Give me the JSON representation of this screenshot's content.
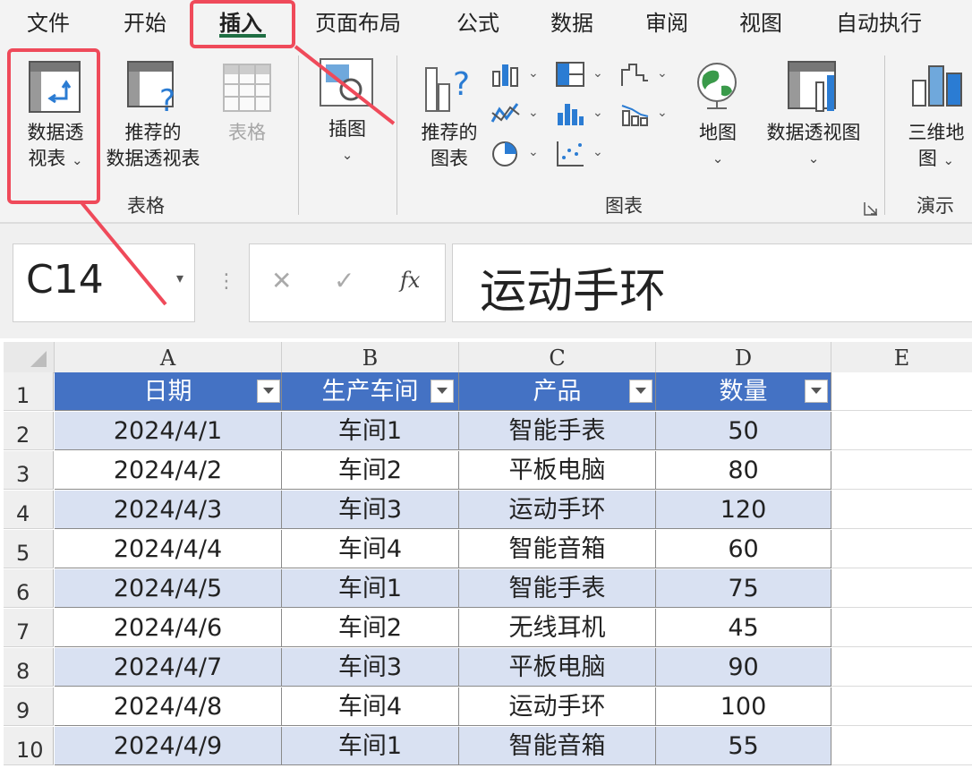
{
  "ribbon_tabs": [
    "文件",
    "开始",
    "插入",
    "页面布局",
    "公式",
    "数据",
    "审阅",
    "视图",
    "自动执行"
  ],
  "ribbon": {
    "pivot_table": {
      "line1": "数据透",
      "line2": "视表"
    },
    "recommended_pivot": {
      "line1": "推荐的",
      "line2": "数据透视表"
    },
    "table": "表格",
    "group_tables": "表格",
    "illustrations": "插图",
    "recommended_charts": {
      "line1": "推荐的",
      "line2": "图表"
    },
    "map": "地图",
    "pivot_chart": "数据透视图",
    "group_charts": "图表",
    "map_3d": {
      "line1": "三维地",
      "line2": "图"
    },
    "group_tours": "演示"
  },
  "formula_bar": {
    "name_box": "C14",
    "cancel_glyph": "✕",
    "enter_glyph": "✓",
    "fx_glyph": "fx",
    "content": "运动手环"
  },
  "sheet": {
    "column_letters": [
      "A",
      "B",
      "C",
      "D",
      "E"
    ],
    "headers": [
      "日期",
      "生产车间",
      "产品",
      "数量"
    ],
    "row_numbers": [
      "1",
      "2",
      "3",
      "4",
      "5",
      "6",
      "7",
      "8",
      "9",
      "10"
    ],
    "rows": [
      [
        "2024/4/1",
        "车间1",
        "智能手表",
        "50"
      ],
      [
        "2024/4/2",
        "车间2",
        "平板电脑",
        "80"
      ],
      [
        "2024/4/3",
        "车间3",
        "运动手环",
        "120"
      ],
      [
        "2024/4/4",
        "车间4",
        "智能音箱",
        "60"
      ],
      [
        "2024/4/5",
        "车间1",
        "智能手表",
        "75"
      ],
      [
        "2024/4/6",
        "车间2",
        "无线耳机",
        "45"
      ],
      [
        "2024/4/7",
        "车间3",
        "平板电脑",
        "90"
      ],
      [
        "2024/4/8",
        "车间4",
        "运动手环",
        "100"
      ],
      [
        "2024/4/9",
        "车间1",
        "智能音箱",
        "55"
      ]
    ]
  },
  "colors": {
    "header_fill": "#4472c4",
    "band_fill": "#d9e1f2",
    "highlight": "#ef4a5a",
    "active_tab_underline": "#1f6e43"
  }
}
